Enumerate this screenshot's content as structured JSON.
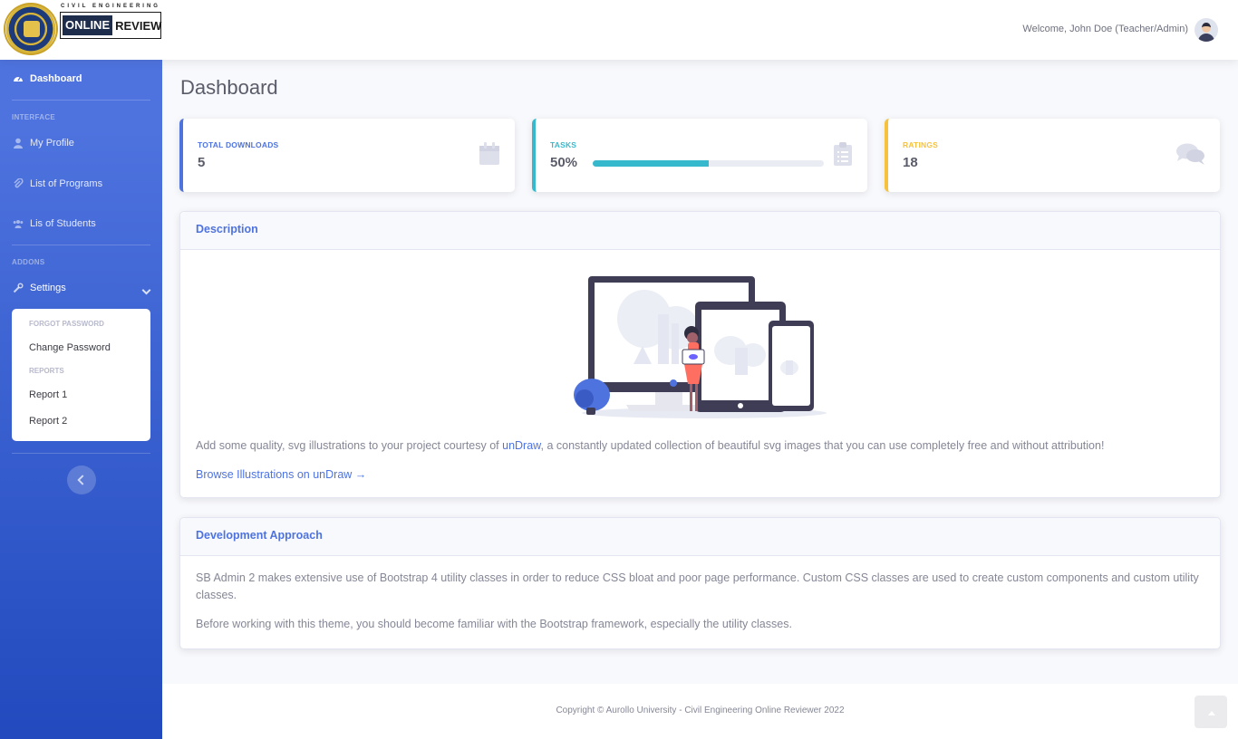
{
  "header": {
    "logo_top_text": "CIVIL ENGINEERING",
    "logo_online": "ONLINE",
    "logo_review": "REVIEW",
    "welcome": "Welcome, John Doe (Teacher/Admin)"
  },
  "sidebar": {
    "dashboard": "Dashboard",
    "heading_interface": "INTERFACE",
    "my_profile": "My Profile",
    "list_programs": "List of Programs",
    "list_students": "Lis of Students",
    "heading_addons": "ADDONS",
    "settings": "Settings",
    "submenu": {
      "heading_forgot": "FORGOT PASSWORD",
      "change_password": "Change Password",
      "heading_reports": "REPORTS",
      "report1": "Report 1",
      "report2": "Report 2"
    }
  },
  "page": {
    "title": "Dashboard"
  },
  "stats": {
    "downloads_label": "TOTAL DOWNLOADS",
    "downloads_value": "5",
    "tasks_label": "TASKS",
    "tasks_value": "50%",
    "tasks_progress": 0.5,
    "ratings_label": "RATINGS",
    "ratings_value": "18"
  },
  "description": {
    "title": "Description",
    "text_before": "Add some quality, svg illustrations to your project courtesy of ",
    "link_undraw": "unDraw",
    "text_after": ", a constantly updated collection of beautiful svg images that you can use completely free and without attribution!",
    "browse_link": "Browse Illustrations on unDraw →"
  },
  "development": {
    "title": "Development Approach",
    "p1": "SB Admin 2 makes extensive use of Bootstrap 4 utility classes in order to reduce CSS bloat and poor page performance. Custom CSS classes are used to create custom components and custom utility classes.",
    "p2": "Before working with this theme, you should become familiar with the Bootstrap framework, especially the utility classes."
  },
  "footer": {
    "copyright": "Copyright © Aurollo University - Civil Engineering Online Reviewer 2022"
  },
  "colors": {
    "primary": "#4e73df",
    "info": "#36b9cc",
    "warning": "#f6c23e",
    "sidebar_gradient_end": "#224abe"
  }
}
